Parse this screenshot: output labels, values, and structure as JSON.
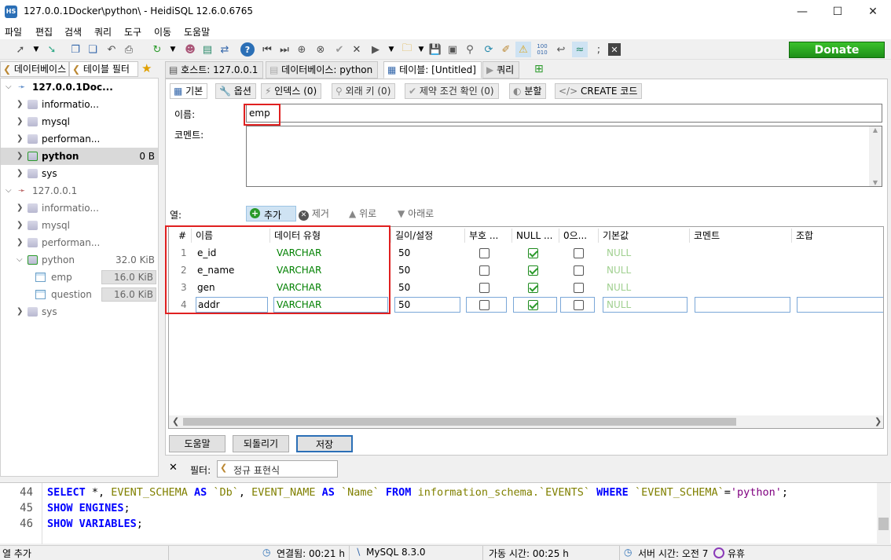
{
  "window": {
    "title": "127.0.0.1Docker\\python\\ - HeidiSQL 12.6.0.6765",
    "app_icon": "HS"
  },
  "menu": [
    "파일",
    "편집",
    "검색",
    "쿼리",
    "도구",
    "이동",
    "도움말"
  ],
  "donate_label": "Donate",
  "left_tabs": {
    "database": "데이터베이스",
    "table_filter": "테이블 필터"
  },
  "tree": [
    {
      "label": "127.0.0.1Doc...",
      "size": "",
      "level": 0,
      "expanded": true,
      "bold": true
    },
    {
      "label": "informatio...",
      "size": "",
      "level": 1
    },
    {
      "label": "mysql",
      "size": "",
      "level": 1
    },
    {
      "label": "performan...",
      "size": "",
      "level": 1
    },
    {
      "label": "python",
      "size": "0 B",
      "level": 1,
      "bold": true,
      "selected": true
    },
    {
      "label": "sys",
      "size": "",
      "level": 1
    },
    {
      "label": "127.0.0.1",
      "size": "",
      "level": 0,
      "expanded": true
    },
    {
      "label": "informatio...",
      "size": "",
      "level": 1
    },
    {
      "label": "mysql",
      "size": "",
      "level": 1
    },
    {
      "label": "performan...",
      "size": "",
      "level": 1
    },
    {
      "label": "python",
      "size": "32.0 KiB",
      "level": 1,
      "expanded": true
    },
    {
      "label": "emp",
      "size": "16.0 KiB",
      "level": 2
    },
    {
      "label": "question",
      "size": "16.0 KiB",
      "level": 2
    },
    {
      "label": "sys",
      "size": "",
      "level": 1
    }
  ],
  "main_tabs": {
    "host": "호스트: 127.0.0.1",
    "database": "데이터베이스: python",
    "table": "테이블: [Untitled]",
    "query": "쿼리"
  },
  "sub_tabs": {
    "basic": "기본",
    "options": "옵션",
    "indexes": "인덱스 (0)",
    "foreign_keys": "외래 키 (0)",
    "check": "제약 조건 확인 (0)",
    "partitions": "분할",
    "create_code": "CREATE 코드"
  },
  "form": {
    "name_label": "이름:",
    "name_value": "emp",
    "comment_label": "코멘트:",
    "comment_value": ""
  },
  "columns_toolbar": {
    "label": "열:",
    "add": "추가",
    "remove": "제거",
    "up": "위로",
    "down": "아래로"
  },
  "grid": {
    "headers": [
      "#",
      "이름",
      "데이터 유형",
      "길이/설정",
      "부호 ...",
      "NULL ...",
      "0으...",
      "기본값",
      "코멘트",
      "조합"
    ],
    "rows": [
      {
        "num": "1",
        "name": "e_id",
        "type": "VARCHAR",
        "length": "50",
        "unsigned": false,
        "null": true,
        "zerofill": false,
        "default": "NULL"
      },
      {
        "num": "2",
        "name": "e_name",
        "type": "VARCHAR",
        "length": "50",
        "unsigned": false,
        "null": true,
        "zerofill": false,
        "default": "NULL"
      },
      {
        "num": "3",
        "name": "gen",
        "type": "VARCHAR",
        "length": "50",
        "unsigned": false,
        "null": true,
        "zerofill": false,
        "default": "NULL"
      },
      {
        "num": "4",
        "name": "addr",
        "type": "VARCHAR",
        "length": "50",
        "unsigned": false,
        "null": true,
        "zerofill": false,
        "default": "NULL"
      }
    ]
  },
  "buttons": {
    "help": "도움말",
    "revert": "되돌리기",
    "save": "저장"
  },
  "filter": {
    "close": "✕",
    "label": "필터:",
    "placeholder": "정규 표현식"
  },
  "sql_log": [
    {
      "line": "44"
    },
    {
      "line": "45"
    },
    {
      "line": "46"
    }
  ],
  "status": {
    "left": "열 추가",
    "connected": "연결됨: 00:21 h",
    "server": "MySQL 8.3.0",
    "uptime": "가동 시간: 00:25 h",
    "server_time": "서버 시간: 오전 7",
    "idle": "유휴"
  },
  "colors": {
    "accent_red": "#e02020",
    "donate_green": "#1d8f18",
    "type_green": "#008000",
    "sql_keyword": "#0000ff"
  }
}
